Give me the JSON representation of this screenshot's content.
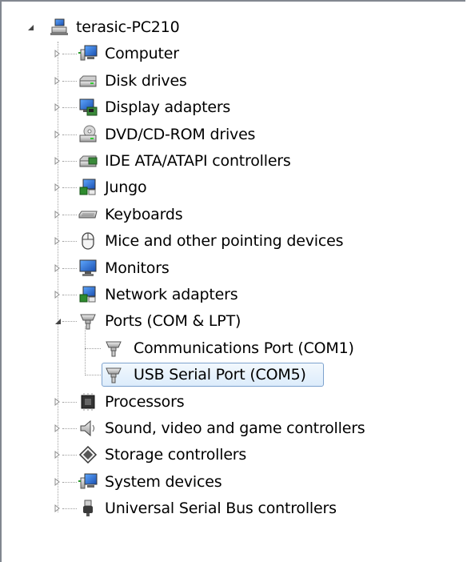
{
  "root": {
    "label": "terasic-PC210",
    "expanded": true,
    "icon": "computer-network-icon"
  },
  "items": [
    {
      "label": "Computer",
      "icon": "computer-icon",
      "expanded": false
    },
    {
      "label": "Disk drives",
      "icon": "disk-drive-icon",
      "expanded": false
    },
    {
      "label": "Display adapters",
      "icon": "display-adapter-icon",
      "expanded": false
    },
    {
      "label": "DVD/CD-ROM drives",
      "icon": "dvd-drive-icon",
      "expanded": false
    },
    {
      "label": "IDE ATA/ATAPI controllers",
      "icon": "ide-controller-icon",
      "expanded": false
    },
    {
      "label": "Jungo",
      "icon": "jungo-device-icon",
      "expanded": false
    },
    {
      "label": "Keyboards",
      "icon": "keyboard-icon",
      "expanded": false
    },
    {
      "label": "Mice and other pointing devices",
      "icon": "mouse-icon",
      "expanded": false
    },
    {
      "label": "Monitors",
      "icon": "monitor-icon",
      "expanded": false
    },
    {
      "label": "Network adapters",
      "icon": "network-adapter-icon",
      "expanded": false
    },
    {
      "label": "Ports (COM & LPT)",
      "icon": "port-icon",
      "expanded": true,
      "children": [
        {
          "label": "Communications Port (COM1)",
          "icon": "port-icon",
          "selected": false
        },
        {
          "label": "USB Serial Port (COM5)",
          "icon": "port-icon",
          "selected": true
        }
      ]
    },
    {
      "label": "Processors",
      "icon": "processor-icon",
      "expanded": false
    },
    {
      "label": "Sound, video and game controllers",
      "icon": "speaker-icon",
      "expanded": false
    },
    {
      "label": "Storage controllers",
      "icon": "storage-controller-icon",
      "expanded": false
    },
    {
      "label": "System devices",
      "icon": "system-devices-icon",
      "expanded": false
    },
    {
      "label": "Universal Serial Bus controllers",
      "icon": "usb-icon",
      "expanded": false
    }
  ],
  "colors": {
    "selection_border": "#7da2ce",
    "selection_fill": "#dcecfb",
    "window_border": "#828790"
  }
}
